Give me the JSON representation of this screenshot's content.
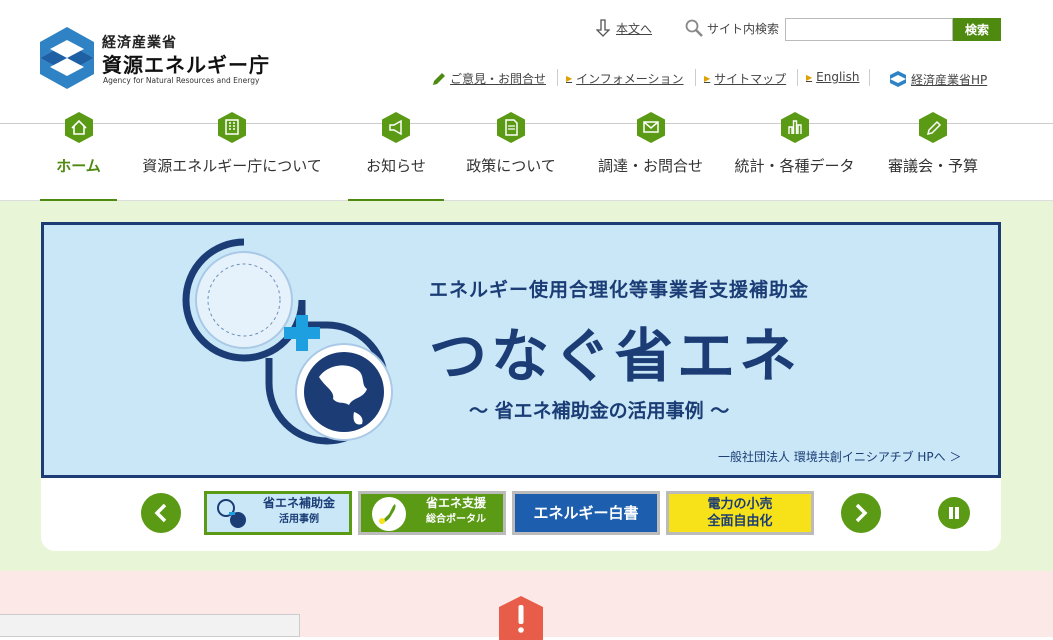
{
  "header": {
    "ministry": "経済産業省",
    "agency": "資源エネルギー庁",
    "agency_en": "Agency for Natural Resources and Energy",
    "skip_label": "本文へ",
    "search_label": "サイト内検索",
    "search_value": "",
    "search_button": "検索",
    "util_links": [
      {
        "label": "ご意見・お問合せ",
        "icon": "pencil-icon"
      },
      {
        "label": "インフォメーション",
        "icon": "triangle-icon"
      },
      {
        "label": "サイトマップ",
        "icon": "triangle-icon"
      },
      {
        "label": "English",
        "icon": "triangle-icon"
      },
      {
        "label": "経済産業省HP",
        "icon": "meti-logo-icon"
      }
    ]
  },
  "nav": {
    "items": [
      {
        "label": "ホーム",
        "icon": "home-icon",
        "active": true
      },
      {
        "label": "資源エネルギー庁について",
        "icon": "building-icon",
        "active": false
      },
      {
        "label": "お知らせ",
        "icon": "megaphone-icon",
        "active": true
      },
      {
        "label": "政策について",
        "icon": "document-icon",
        "active": false
      },
      {
        "label": "調達・お問合せ",
        "icon": "mail-icon",
        "active": false
      },
      {
        "label": "統計・各種データ",
        "icon": "bar-chart-icon",
        "active": false
      },
      {
        "label": "審議会・予算",
        "icon": "pencil-icon",
        "active": false
      }
    ]
  },
  "banner": {
    "subtitle": "エネルギー使用合理化等事業者支援補助金",
    "title": "つなぐ省エネ",
    "tagline": "〜 省エネ補助金の活用事例 〜",
    "link": "一般社団法人 環境共創イニシアチブ HPへ ＞"
  },
  "carousel": {
    "prev": "‹",
    "next": "›",
    "thumbs": [
      {
        "line1": "省エネ補助金",
        "line2": "活用事例"
      },
      {
        "line1": "省エネ支援",
        "line2": "総合ポータル"
      },
      {
        "line1": "エネルギー白書",
        "line2": ""
      },
      {
        "line1": "電力の小売",
        "line2": "全面自由化"
      }
    ]
  },
  "alert": {
    "icon": "exclamation-icon",
    "color": "#e85c4a"
  },
  "colors": {
    "brand_green": "#4f8a10",
    "banner_navy": "#1b3c75",
    "banner_bg": "#c9e7f7"
  }
}
